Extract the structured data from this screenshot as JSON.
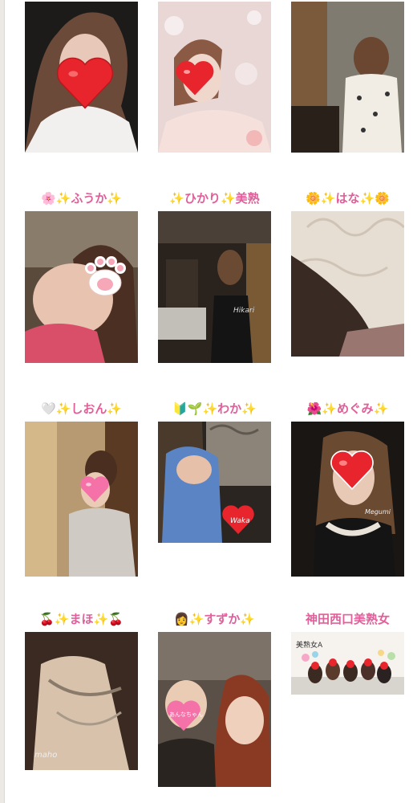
{
  "colors": {
    "label_pink": "#e0609a",
    "heart_red": "#e8242c",
    "heart_pink": "#f472a8"
  },
  "gallery": [
    {
      "name": "",
      "photo_caption": ""
    },
    {
      "name": "",
      "photo_caption": ""
    },
    {
      "name": "",
      "photo_caption": ""
    },
    {
      "name": "🌸✨ふうか✨",
      "photo_caption": ""
    },
    {
      "name": "✨ひかり✨美熟",
      "photo_caption": "Hikari"
    },
    {
      "name": "🌼✨はな✨🌼",
      "photo_caption": ""
    },
    {
      "name": "🤍✨しおん✨",
      "photo_caption": ""
    },
    {
      "name": "🔰🌱✨わか✨",
      "photo_caption": "Waka"
    },
    {
      "name": "🌺✨めぐみ✨",
      "photo_caption": "Megumi"
    },
    {
      "name": "🍒✨まほ✨🍒",
      "photo_caption": "maho"
    },
    {
      "name": "👩✨すずか✨",
      "photo_caption": "あんなちゃん"
    },
    {
      "name": "神田西口美熟女",
      "photo_caption": "美熟女A"
    }
  ]
}
